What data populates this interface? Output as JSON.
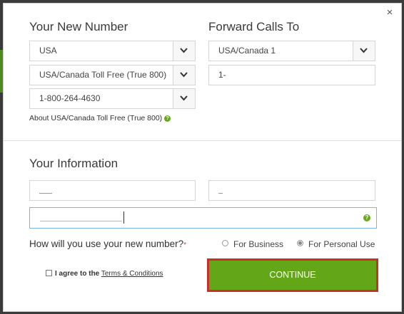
{
  "number_section": {
    "heading": "Your New Number",
    "country": "USA",
    "number_type": "USA/Canada Toll Free (True 800)",
    "selected_number": "1-800-264-4630",
    "about_link": "About USA/Canada Toll Free (True 800)"
  },
  "forward_section": {
    "heading": "Forward Calls To",
    "country_code": "USA/Canada 1",
    "phone_value": "1-"
  },
  "info_section": {
    "heading": "Your Information"
  },
  "usage": {
    "question": "How will you use your new number?",
    "required_mark": "*",
    "option_business": "For Business",
    "option_personal": "For Personal Use",
    "selected": "For Personal Use"
  },
  "agree": {
    "prefix": "I agree to the",
    "link": "Terms & Conditions"
  },
  "continue_label": "CONTINUE",
  "close_label": "×",
  "colors": {
    "accent_green": "#63a618",
    "highlight_red": "#c9302c",
    "focus_blue": "#7bb4e6"
  }
}
